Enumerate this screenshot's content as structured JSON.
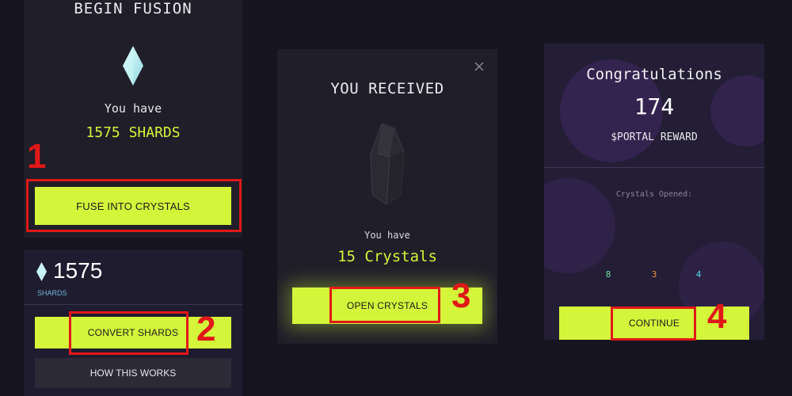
{
  "fusion_panel": {
    "title": "BEGIN FUSION",
    "you_have_label": "You have",
    "shards_text": "1575 SHARDS",
    "fuse_button": "FUSE INTO CRYSTALS"
  },
  "shards_panel": {
    "count": "1575",
    "unit_label": "SHARDS",
    "convert_button": "CONVERT SHARDS",
    "how_button": "HOW THIS WORKS"
  },
  "received_panel": {
    "title": "YOU RECEIVED",
    "you_have_label": "You have",
    "crystals_text": "15 Crystals",
    "open_button": "OPEN CRYSTALS"
  },
  "congrats_panel": {
    "title": "Congratulations",
    "amount": "174",
    "reward_label": "$PORTAL REWARD",
    "opened_label": "Crystals Opened:",
    "counts": [
      {
        "value": "8",
        "color": "#6fe0a0"
      },
      {
        "value": "3",
        "color": "#f0913a"
      },
      {
        "value": "4",
        "color": "#4fd6e8"
      }
    ],
    "continue_button": "CONTINUE"
  },
  "step_labels": [
    "1",
    "2",
    "3",
    "4"
  ],
  "colors": {
    "accent": "#d4f53a",
    "highlight_red": "#e01818",
    "panel_bg": "#1f1e29",
    "page_bg": "#16141f"
  },
  "icons": [
    "diamond-icon",
    "crystal-icon",
    "close-icon"
  ]
}
